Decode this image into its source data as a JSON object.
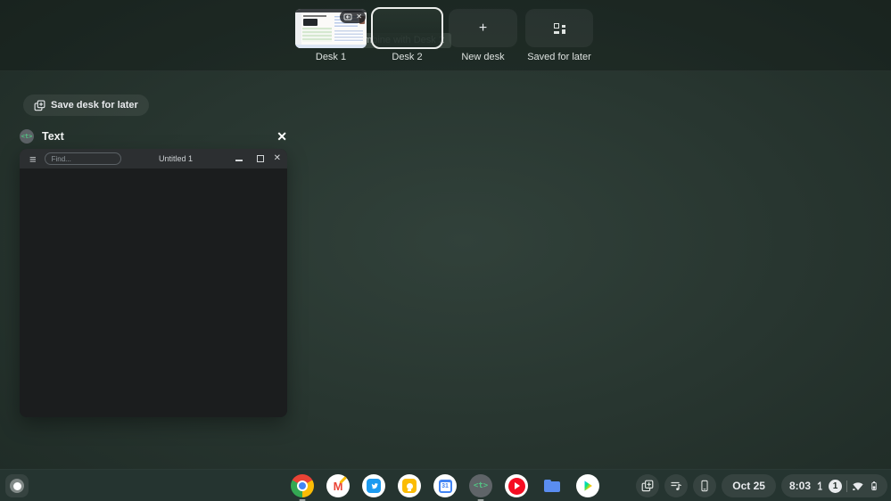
{
  "icons": {
    "close": "✕",
    "plus": "+",
    "hamburger": "≡"
  },
  "colors": {
    "wallpaper_teal": "#283630",
    "shelf": "#253430",
    "active_desk_border": "#eceeec",
    "text_primary": "#e8eaed",
    "text_app_green": "#53c283",
    "chrome_red": "#ea4335",
    "chrome_yellow": "#fbbc05",
    "chrome_green": "#34a853",
    "chrome_blue": "#4285f4",
    "twitter_blue": "#1d9bf0",
    "keep_yellow": "#fbbc05",
    "calendar_blue": "#4285f4",
    "youtube_music_red": "#f50d22",
    "files_blue": "#5a8df0"
  },
  "desks_bar": {
    "desks": [
      {
        "label": "Desk 1",
        "active": false
      },
      {
        "label": "Desk 2",
        "active": true
      }
    ],
    "new_desk": {
      "label": "New desk",
      "glyph": "+"
    },
    "saved_for_later": {
      "label": "Saved for later"
    },
    "combine_tooltip": "Combine with Desk 2"
  },
  "save_desk_button": {
    "label": "Save desk for later"
  },
  "window_preview": {
    "app_title": "Text",
    "app_icon_glyph": "<t>",
    "close_glyph": "✕",
    "window": {
      "menu_glyph": "≡",
      "find_placeholder": "Find...",
      "title": "Untitled 1",
      "close_glyph": "✕"
    }
  },
  "shelf": {
    "apps": [
      {
        "name": "chrome",
        "running": true
      },
      {
        "name": "gmail",
        "running": false
      },
      {
        "name": "twitter",
        "running": false
      },
      {
        "name": "keep",
        "running": false
      },
      {
        "name": "calendar",
        "running": false
      },
      {
        "name": "text",
        "running": true
      },
      {
        "name": "youtube-music",
        "running": false
      },
      {
        "name": "files",
        "running": false
      },
      {
        "name": "play-store",
        "running": false
      }
    ],
    "app_glyphs": {
      "gmail": "M",
      "calendar": "31",
      "text": "<t>"
    },
    "tray": {
      "date": "Oct 25",
      "time": "8:03",
      "notification_count": "1"
    }
  }
}
